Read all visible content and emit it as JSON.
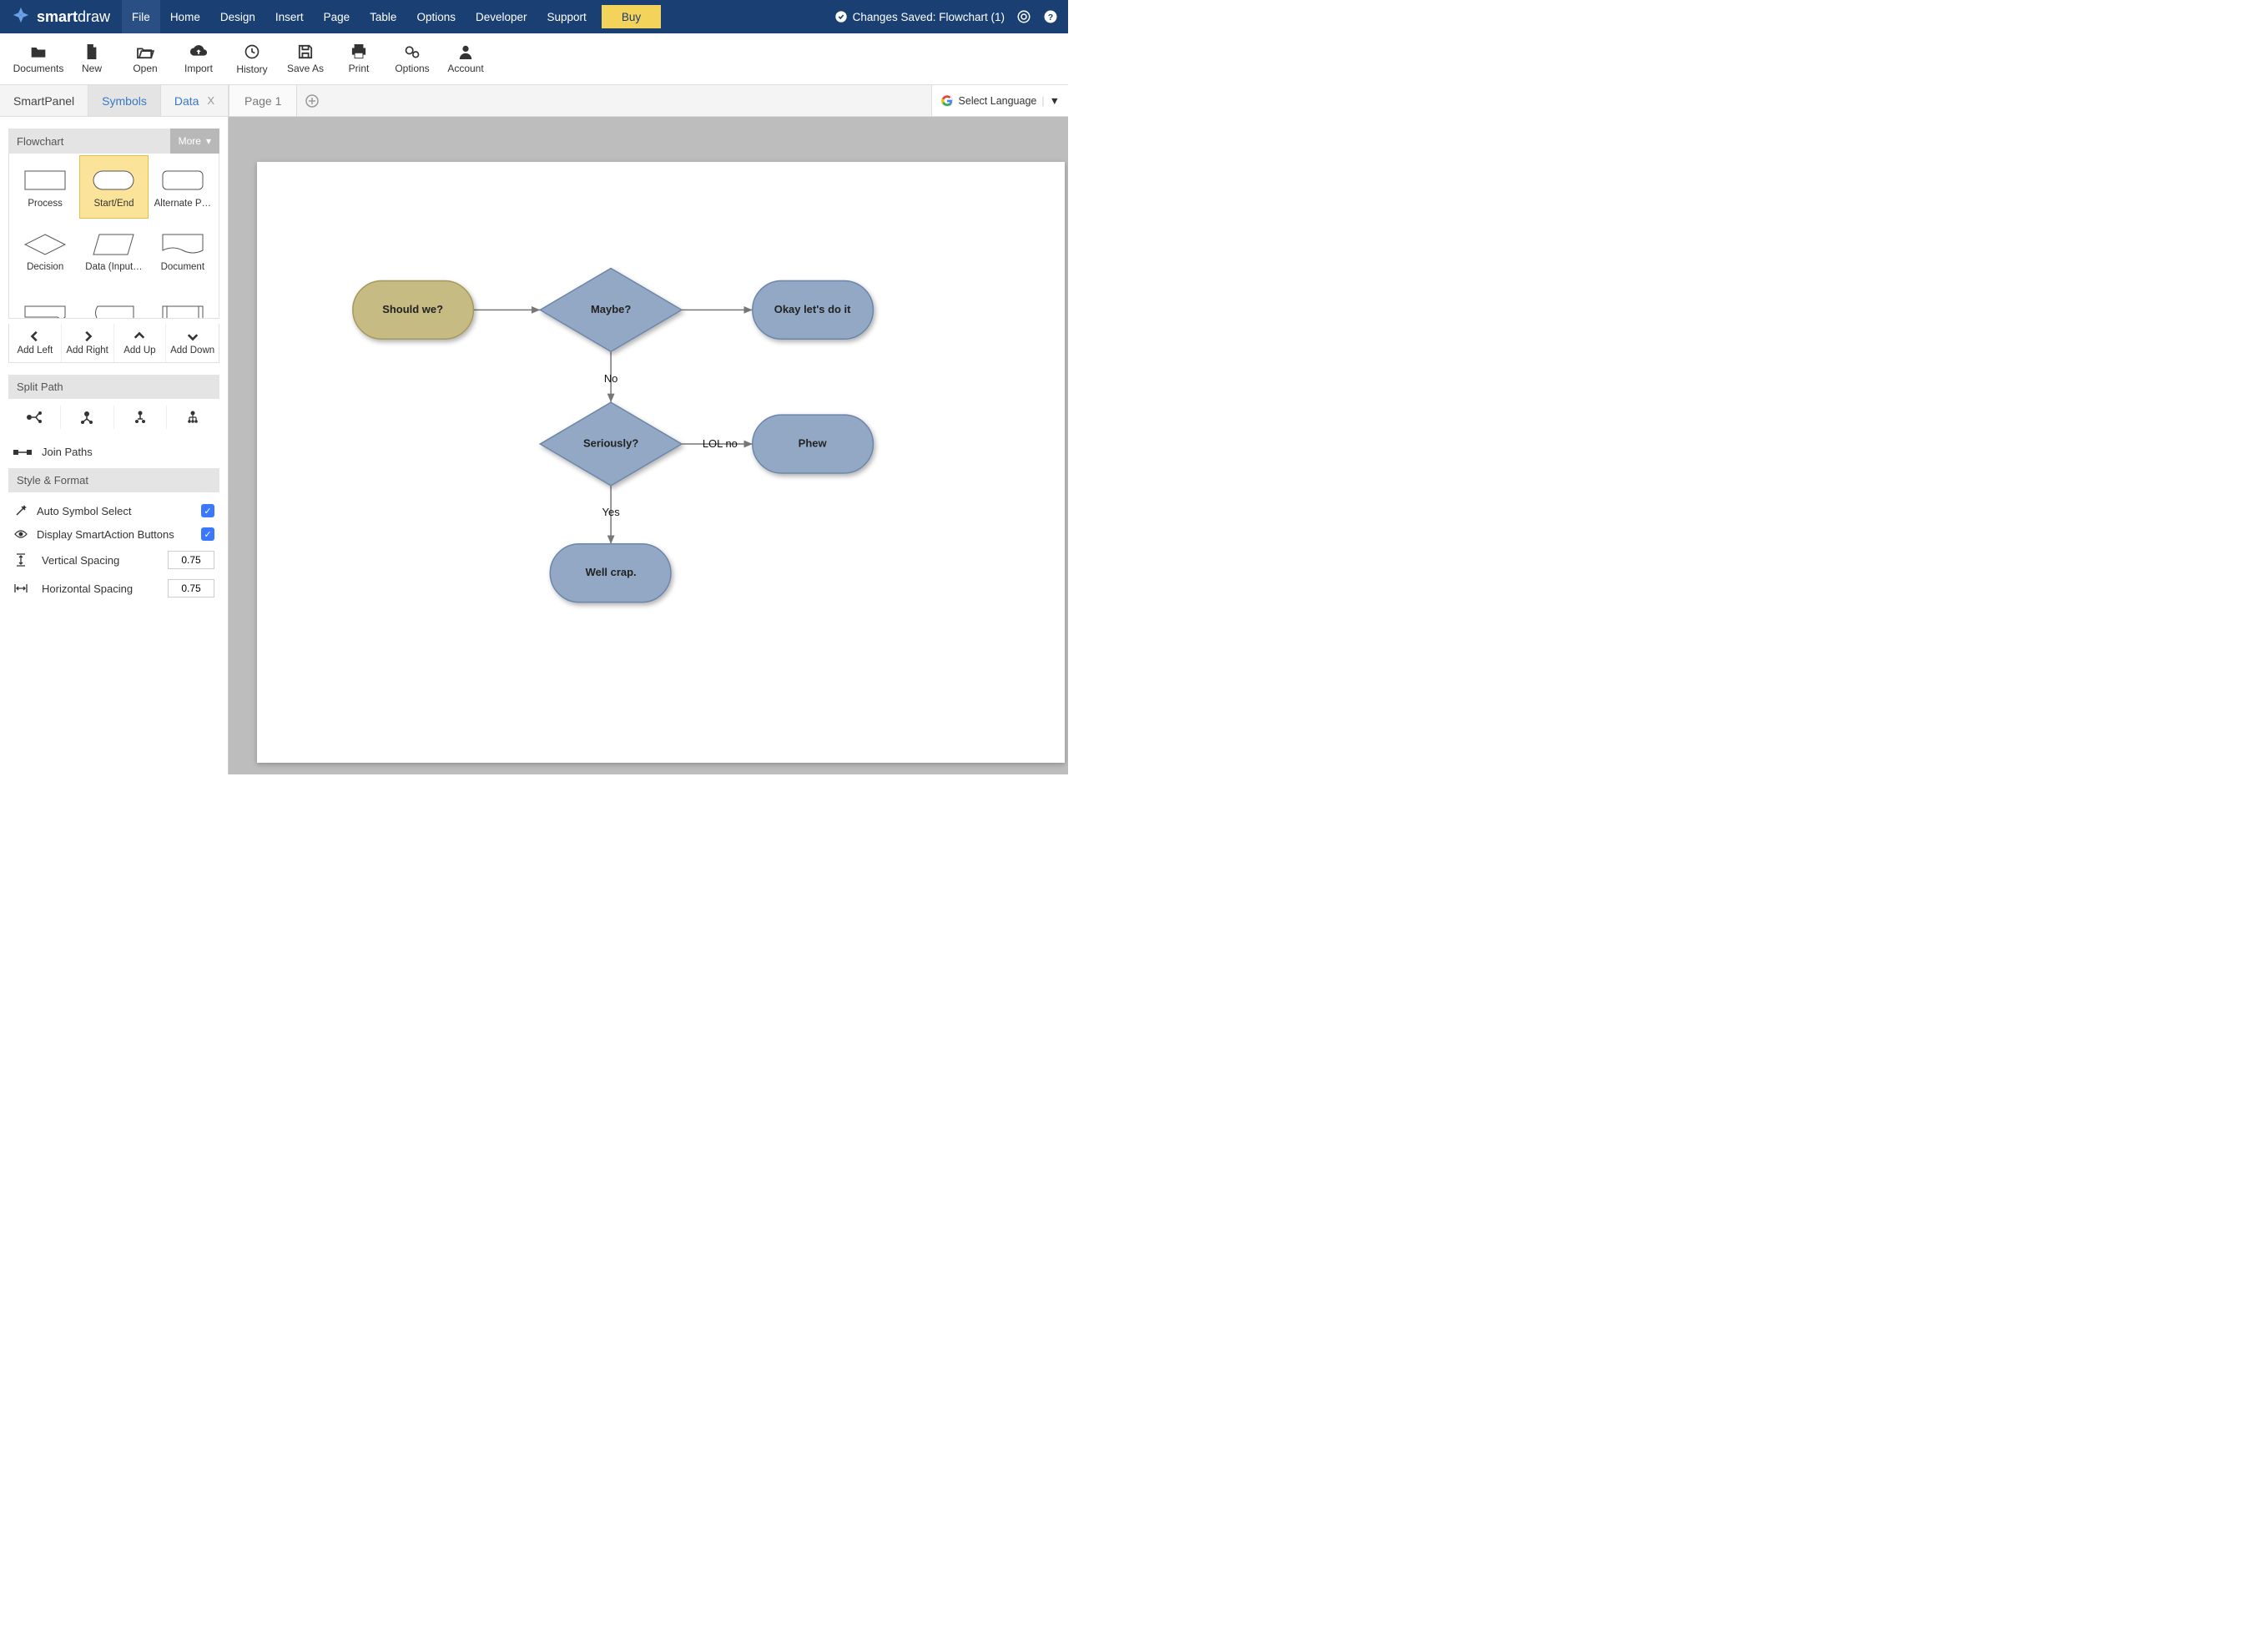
{
  "brand": {
    "name_bold": "smart",
    "name_light": "draw"
  },
  "menu": {
    "items": [
      "File",
      "Home",
      "Design",
      "Insert",
      "Page",
      "Table",
      "Options",
      "Developer",
      "Support"
    ],
    "active": "File",
    "buy": "Buy",
    "save_status": "Changes Saved: Flowchart (1)"
  },
  "toolbar": [
    {
      "id": "documents",
      "label": "Documents",
      "icon": "folder"
    },
    {
      "id": "new",
      "label": "New",
      "icon": "file"
    },
    {
      "id": "open",
      "label": "Open",
      "icon": "folder-open"
    },
    {
      "id": "import",
      "label": "Import",
      "icon": "cloud-up"
    },
    {
      "id": "history",
      "label": "History",
      "icon": "clock"
    },
    {
      "id": "saveas",
      "label": "Save As",
      "icon": "save"
    },
    {
      "id": "print",
      "label": "Print",
      "icon": "print"
    },
    {
      "id": "options",
      "label": "Options",
      "icon": "gears"
    },
    {
      "id": "account",
      "label": "Account",
      "icon": "user"
    }
  ],
  "panel_tabs": {
    "smart": "SmartPanel",
    "symbols": "Symbols",
    "data": "Data"
  },
  "pages": {
    "page1": "Page 1"
  },
  "lang": {
    "label": "Select Language"
  },
  "sidebar": {
    "flowchart_header": "Flowchart",
    "more": "More",
    "shapes": [
      {
        "id": "process",
        "label": "Process"
      },
      {
        "id": "startend",
        "label": "Start/End",
        "selected": true
      },
      {
        "id": "altproc",
        "label": "Alternate P…"
      },
      {
        "id": "decision",
        "label": "Decision"
      },
      {
        "id": "data",
        "label": "Data (Input…"
      },
      {
        "id": "document",
        "label": "Document"
      }
    ],
    "add_dir": {
      "left": "Add Left",
      "right": "Add Right",
      "up": "Add Up",
      "down": "Add Down"
    },
    "split_header": "Split Path",
    "join": "Join Paths",
    "style_header": "Style & Format",
    "auto_symbol": "Auto Symbol Select",
    "display_smart": "Display SmartAction Buttons",
    "vspacing_label": "Vertical Spacing",
    "vspacing_value": "0.75",
    "hspacing_label": "Horizontal Spacing",
    "hspacing_value": "0.75"
  },
  "diagram": {
    "nodes": {
      "start": "Should we?",
      "maybe": "Maybe?",
      "okay": "Okay let's do it",
      "seriously": "Seriously?",
      "phew": "Phew",
      "crap": "Well crap."
    },
    "edges": {
      "no": "No",
      "yes": "Yes",
      "lolno": "LOL no"
    }
  }
}
